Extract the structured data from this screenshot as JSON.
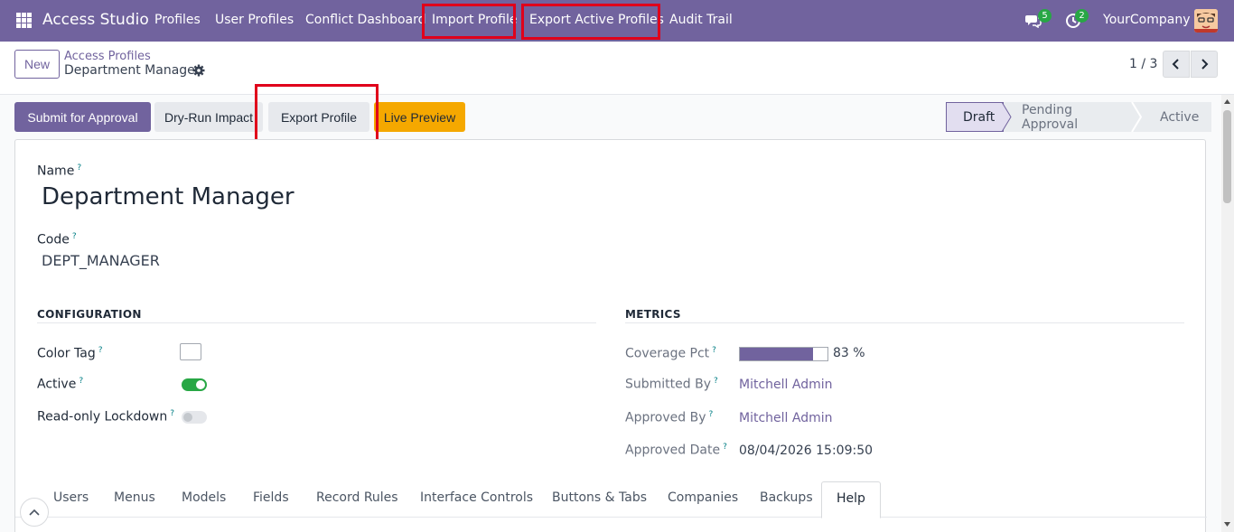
{
  "navbar": {
    "brand": "Access Studio",
    "menu": [
      "Profiles",
      "User Profiles",
      "Conflict Dashboard",
      "Import Profile",
      "Export Active Profiles",
      "Audit Trail"
    ],
    "messages_count": "5",
    "activities_count": "2",
    "company": "YourCompany",
    "color": "#71639e"
  },
  "control": {
    "new_label": "New",
    "breadcrumb_parent": "Access Profiles",
    "breadcrumb_current": "Department Manager",
    "pager": "1 / 3"
  },
  "actions": {
    "submit": "Submit for Approval",
    "dry_run": "Dry-Run Impact",
    "export_profile": "Export Profile",
    "live_preview": "Live Preview"
  },
  "status": {
    "stages": [
      "Draft",
      "Pending Approval",
      "Active"
    ],
    "current": "Draft"
  },
  "form": {
    "name_label": "Name",
    "name_value": "Department Manager",
    "code_label": "Code",
    "code_value": "DEPT_MANAGER",
    "help_mark": "?",
    "configuration": {
      "title": "CONFIGURATION",
      "color_tag_label": "Color Tag",
      "active_label": "Active",
      "active_value": true,
      "lockdown_label": "Read-only Lockdown",
      "lockdown_value": false
    },
    "metrics": {
      "title": "METRICS",
      "coverage_label": "Coverage Pct",
      "coverage_value": 83,
      "coverage_text": "83 %",
      "submitted_by_label": "Submitted By",
      "submitted_by": "Mitchell Admin",
      "approved_by_label": "Approved By",
      "approved_by": "Mitchell Admin",
      "approved_date_label": "Approved Date",
      "approved_date": "08/04/2026 15:09:50"
    },
    "tabs": [
      "Users",
      "Menus",
      "Models",
      "Fields",
      "Record Rules",
      "Interface Controls",
      "Buttons & Tabs",
      "Companies",
      "Backups",
      "Help"
    ],
    "active_tab": "Help"
  },
  "colors": {
    "accent": "#71639e",
    "highlight": "#e0001b",
    "warning_button": "#f5a800",
    "toggle_on": "#28a745"
  }
}
